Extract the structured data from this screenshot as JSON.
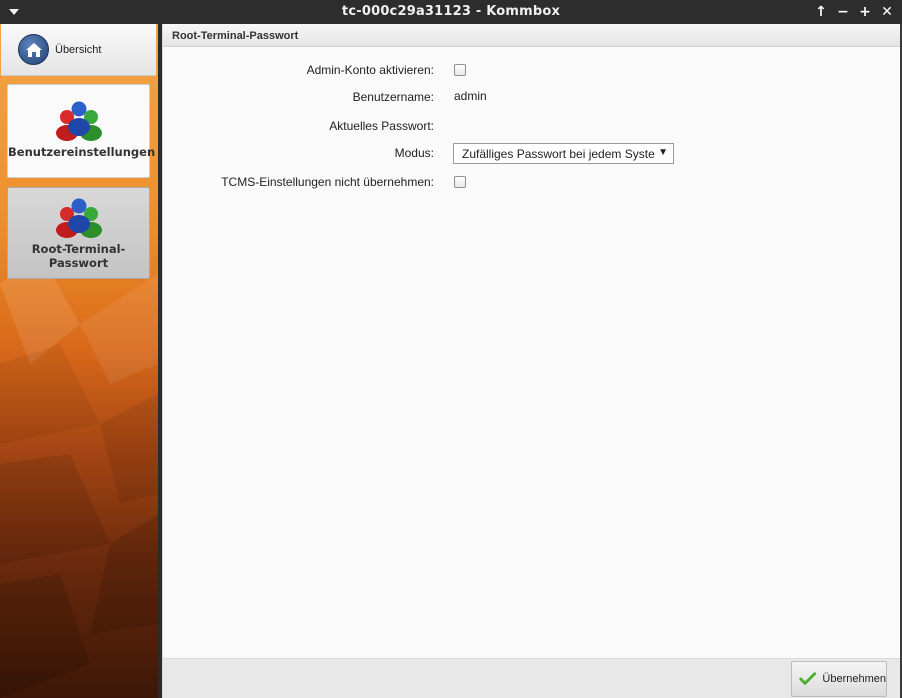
{
  "window": {
    "title": "tc-000c29a31123 - Kommbox",
    "controls": [
      "↑",
      "−",
      "+",
      "✕"
    ]
  },
  "sidebar": {
    "overview_label": "Übersicht",
    "items": [
      {
        "label": "Benutzereinstellungen",
        "icon": "users-icon",
        "active": false
      },
      {
        "label": "Root-Terminal-Passwort",
        "icon": "users-icon",
        "active": true
      }
    ]
  },
  "main": {
    "header": "Root-Terminal-Passwort",
    "form": {
      "admin_enable_label": "Admin-Konto aktivieren:",
      "admin_enable_checked": false,
      "username_label": "Benutzername:",
      "username_value": "admin",
      "current_password_label": "Aktuelles Passwort:",
      "current_password_value": "",
      "mode_label": "Modus:",
      "mode_value": "Zufälliges Passwort bei jedem Syste",
      "tcms_label": "TCMS-Einstellungen nicht übernehmen:",
      "tcms_checked": false
    },
    "footer": {
      "apply_label": "Übernehmen"
    }
  },
  "colors": {
    "titlebar": "#2d2d2d",
    "sidebar_orange": "#ee8e2a",
    "sidebar_dark": "#3c1707",
    "check_green": "#4caf2a"
  }
}
